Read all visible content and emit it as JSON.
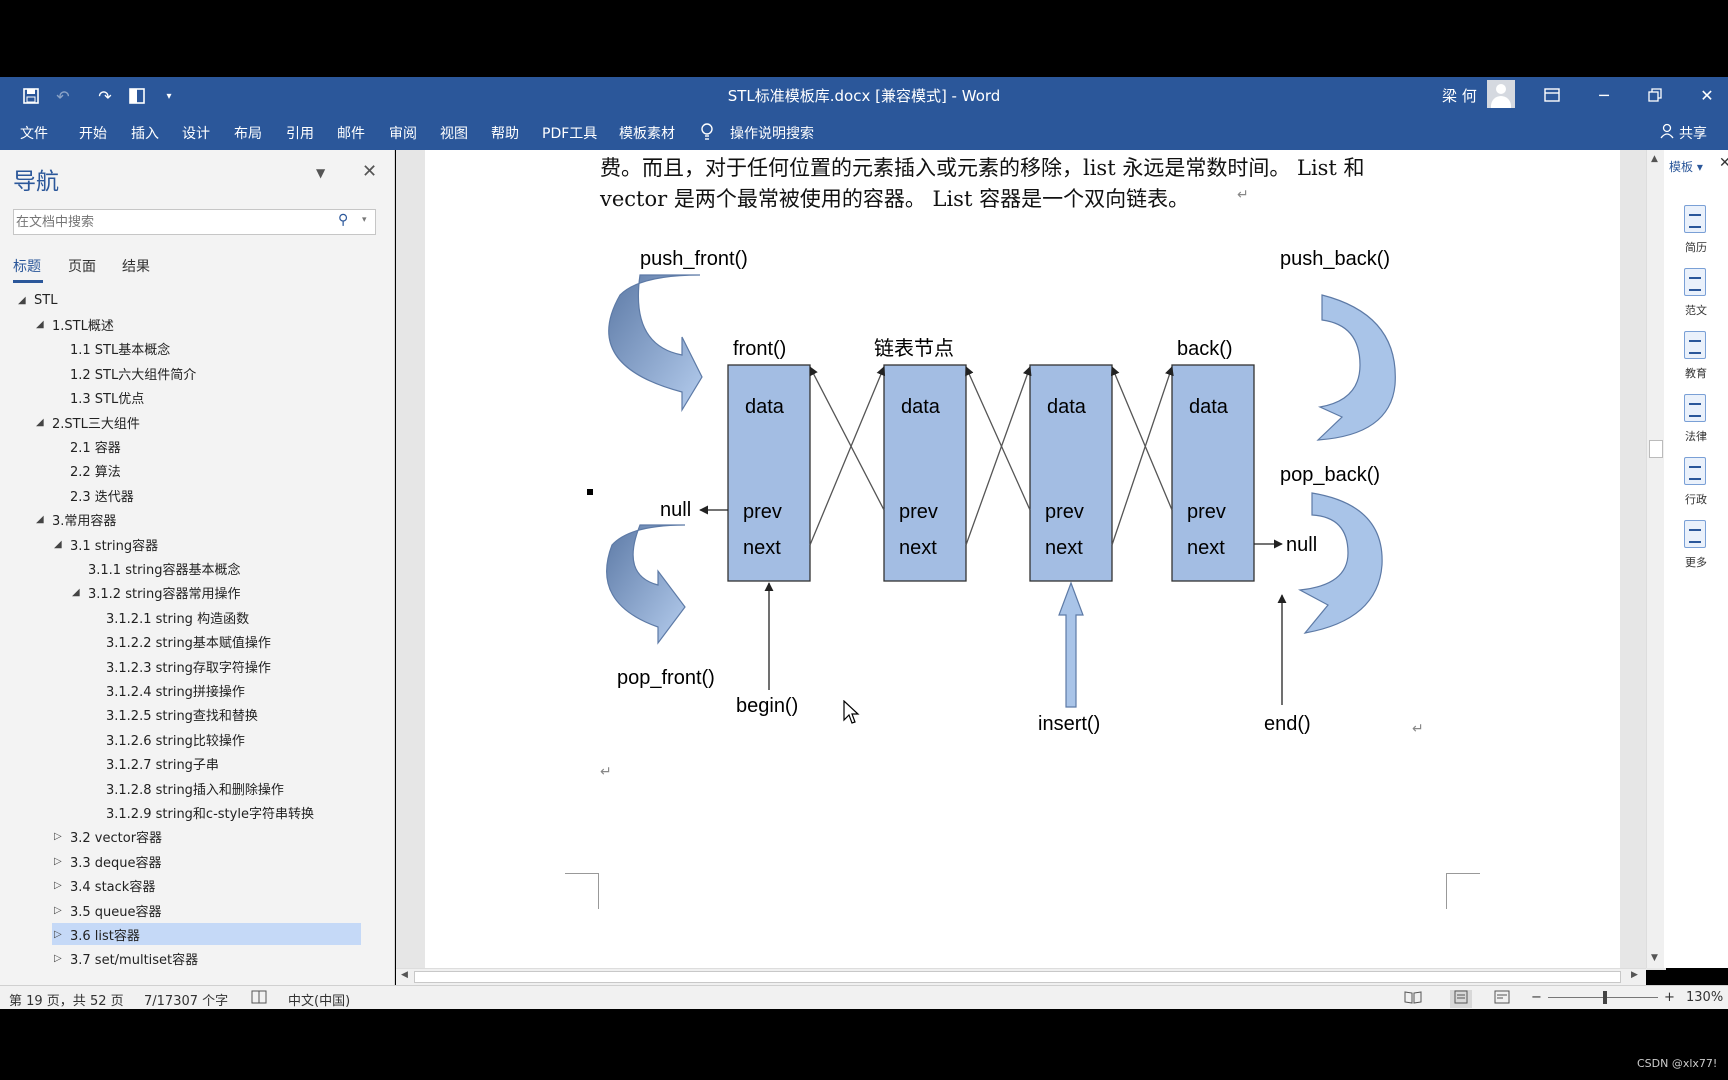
{
  "titlebar": {
    "title": "STL标准模板库.docx [兼容模式] - Word",
    "user": "梁 何"
  },
  "ribbon": {
    "tabs": [
      "文件",
      "开始",
      "插入",
      "设计",
      "布局",
      "引用",
      "邮件",
      "审阅",
      "视图",
      "帮助",
      "PDF工具",
      "模板素材"
    ],
    "tell_me": "操作说明搜索",
    "share": "共享"
  },
  "nav": {
    "title": "导航",
    "search_placeholder": "在文档中搜索",
    "tabs": [
      "标题",
      "页面",
      "结果"
    ],
    "tree": [
      {
        "label": "STL",
        "toggle": "◢"
      },
      {
        "label": "1.STL概述",
        "toggle": "◢"
      },
      {
        "label": "1.1 STL基本概念",
        "toggle": ""
      },
      {
        "label": "1.2 STL六大组件简介",
        "toggle": ""
      },
      {
        "label": "1.3 STL优点",
        "toggle": ""
      },
      {
        "label": "2.STL三大组件",
        "toggle": "◢"
      },
      {
        "label": "2.1 容器",
        "toggle": ""
      },
      {
        "label": "2.2 算法",
        "toggle": ""
      },
      {
        "label": "2.3 迭代器",
        "toggle": ""
      },
      {
        "label": "3.常用容器",
        "toggle": "◢"
      },
      {
        "label": "3.1 string容器",
        "toggle": "◢"
      },
      {
        "label": "3.1.1 string容器基本概念",
        "toggle": ""
      },
      {
        "label": "3.1.2 string容器常用操作",
        "toggle": "◢"
      },
      {
        "label": "3.1.2.1 string 构造函数",
        "toggle": ""
      },
      {
        "label": "3.1.2.2 string基本赋值操作",
        "toggle": ""
      },
      {
        "label": "3.1.2.3 string存取字符操作",
        "toggle": ""
      },
      {
        "label": "3.1.2.4 string拼接操作",
        "toggle": ""
      },
      {
        "label": "3.1.2.5 string查找和替换",
        "toggle": ""
      },
      {
        "label": "3.1.2.6 string比较操作",
        "toggle": ""
      },
      {
        "label": "3.1.2.7 string子串",
        "toggle": ""
      },
      {
        "label": "3.1.2.8 string插入和删除操作",
        "toggle": ""
      },
      {
        "label": "3.1.2.9 string和c-style字符串转换",
        "toggle": ""
      },
      {
        "label": "3.2 vector容器",
        "toggle": "▷"
      },
      {
        "label": "3.3 deque容器",
        "toggle": "▷"
      },
      {
        "label": "3.4 stack容器",
        "toggle": "▷"
      },
      {
        "label": "3.5 queue容器",
        "toggle": "▷"
      },
      {
        "label": "3.6 list容器",
        "toggle": "▷"
      },
      {
        "label": "3.7 set/multiset容器",
        "toggle": "▷"
      }
    ],
    "selected_label": "3.6 list容器"
  },
  "document": {
    "line1": "费。而且，对于任何位置的元素插入或元素的移除，list 永远是常数时间。 List 和",
    "line2": "vector 是两个最常被使用的容器。 List 容器是一个双向链表。",
    "diagram": {
      "push_front": "push_front()",
      "push_back": "push_back()",
      "pop_front": "pop_front()",
      "pop_back": "pop_back()",
      "front": "front()",
      "node_label": "链表节点",
      "back": "back()",
      "null_left": "null",
      "null_right": "null",
      "begin": "begin()",
      "insert": "insert()",
      "end": "end()",
      "data": "data",
      "prev": "prev",
      "next": "next"
    }
  },
  "side_panel": {
    "title": "模板",
    "items": [
      "简历",
      "范文",
      "教育",
      "法律",
      "行政",
      "更多"
    ]
  },
  "status": {
    "page": "第 19 页，共 52 页",
    "words": "7/17307 个字",
    "language": "中文(中国)",
    "zoom": "130%"
  },
  "watermark": "CSDN @xlx77!",
  "colors": {
    "word_blue": "#2b579a",
    "node_fill": "#a3bde3",
    "arrow_fill": "#a9c4e8",
    "arrow_dark": "#5d7aa6"
  }
}
